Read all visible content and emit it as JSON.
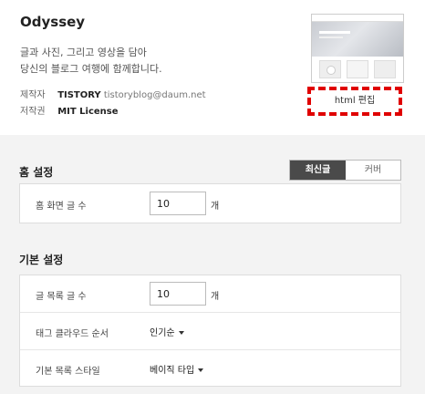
{
  "theme": {
    "name": "Odyssey",
    "description_line1": "글과 사진, 그리고 영상을 담아",
    "description_line2": "당신의 블로그 여행에 함께합니다.",
    "author_label": "제작자",
    "author_name": "TISTORY",
    "author_email": "tistoryblog@daum.net",
    "license_label": "저작권",
    "license_value": "MIT License",
    "html_edit_label": "html 편집"
  },
  "home_settings": {
    "title": "홈 설정",
    "toggle": {
      "active": "최신글",
      "inactive": "커버"
    },
    "rows": [
      {
        "label": "홈 화면 글 수",
        "value": "10",
        "unit": "개"
      }
    ]
  },
  "basic_settings": {
    "title": "기본 설정",
    "post_count": {
      "label": "글 목록 글 수",
      "value": "10",
      "unit": "개"
    },
    "tag_cloud_order": {
      "label": "태그 클라우드 순서",
      "value": "인기순"
    },
    "list_style": {
      "label": "기본 목록 스타일",
      "value": "베이직 타입"
    }
  },
  "colors": {
    "highlight_dashed": "#e00000",
    "toggle_active_bg": "#4a4a4a",
    "settings_bg": "#f3f3f3"
  }
}
